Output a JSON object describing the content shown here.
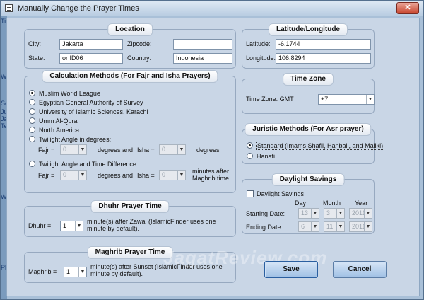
{
  "window": {
    "title": "Manually Change the Prayer Times",
    "close_glyph": "✕"
  },
  "edge_text": [
    "Ti",
    "W",
    "Se",
    "Ju",
    "Ja",
    "Te",
    "W",
    "Ph"
  ],
  "location": {
    "title": "Location",
    "city_label": "City:",
    "city_value": "Jakarta",
    "zipcode_label": "Zipcode:",
    "zipcode_value": "",
    "state_label": "State:",
    "state_value": "or ID06",
    "country_label": "Country:",
    "country_value": "Indonesia"
  },
  "latlong": {
    "title": "Latitude/Longitude",
    "latitude_label": "Latitude:",
    "latitude_value": "-6,1744",
    "longitude_label": "Longitude:",
    "longitude_value": "106,8294"
  },
  "calc": {
    "title": "Calculation Methods (For Fajr and Isha Prayers)",
    "options": [
      "Muslim World League",
      "Egyptian General Authority of Survey",
      "University of Islamic Sciences, Karachi",
      "Umm Al-Qura",
      "North America",
      "Twilight Angle in degrees:",
      "Twilight Angle and Time Difference:"
    ],
    "selected_index": 0,
    "fajr_label": "Fajr =",
    "isha_label": "Isha =",
    "fajr_deg": "0",
    "isha_deg": "0",
    "degrees_and": "degrees and",
    "degrees": "degrees",
    "fajr_diff": "0",
    "isha_diff": "0",
    "minutes_after_maghrib": "minutes after Maghrib time"
  },
  "timezone": {
    "title": "Time Zone",
    "label": "Time Zone: GMT",
    "value": "+7"
  },
  "juristic": {
    "title": "Juristic Methods (For Asr prayer)",
    "options": [
      "Standard (Imams Shafii, Hanbali, and Maliki)",
      "Hanafi"
    ],
    "selected_index": 0
  },
  "daylight": {
    "title": "Daylight Savings",
    "checkbox_label": "Daylight Savings",
    "checked": false,
    "day_header": "Day",
    "month_header": "Month",
    "year_header": "Year",
    "starting_label": "Starting Date:",
    "ending_label": "Ending Date:",
    "start_day": "13",
    "start_month": "3",
    "start_year": "2011",
    "end_day": "6",
    "end_month": "11",
    "end_year": "2011"
  },
  "dhuhr": {
    "title": "Dhuhr Prayer Time",
    "label": "Dhuhr =",
    "value": "1",
    "note": "minute(s) after Zawal  (IslamicFinder uses one minute by default)."
  },
  "maghrib": {
    "title": "Maghrib Prayer Time",
    "label": "Maghrib =",
    "value": "1",
    "note": "minute(s) after Sunset (IslamicFinder uses one minute by default)."
  },
  "buttons": {
    "save": "Save",
    "cancel": "Cancel"
  },
  "watermark": "JagatReview.com"
}
